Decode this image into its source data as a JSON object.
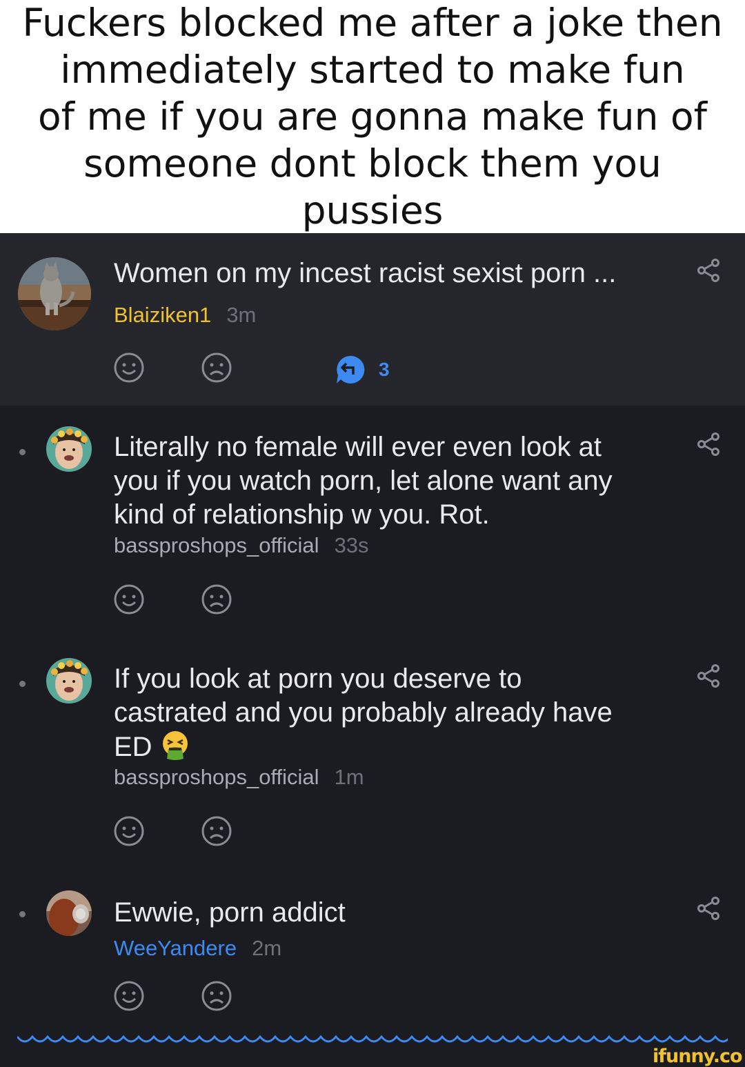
{
  "caption": {
    "line1": "Fuckers blocked me after a joke then",
    "line2": "immediately started to make fun",
    "line3": "of me if you are gonna make fun of",
    "line4": "someone dont block them you pussies"
  },
  "post": {
    "title": "Women on my incest racist sexist porn ...",
    "username": "Blaiziken1",
    "time": "3m",
    "reply_count": "3",
    "avatar_icon": "cat-photo-avatar"
  },
  "comments": [
    {
      "text_lines": [
        "Literally no female will ever even look at",
        "you if you watch porn, let alone want any",
        "kind of relationship w you. Rot."
      ],
      "username": "bassproshops_official",
      "time": "33s",
      "avatar_icon": "flower-crown-avatar"
    },
    {
      "text_lines": [
        "If you look at porn you deserve to",
        "castrated and you probably already have",
        "ED"
      ],
      "emoji": "vomiting-face-emoji",
      "username": "bassproshops_official",
      "time": "1m",
      "avatar_icon": "flower-crown-avatar"
    },
    {
      "text_lines": [
        "Ewwie, porn addict"
      ],
      "username": "WeeYandere",
      "time": "2m",
      "avatar_icon": "redhead-photo-avatar"
    }
  ],
  "branding": {
    "logo": "ifunny.co"
  },
  "colors": {
    "background": "#1b1c21",
    "op_background": "#25262b",
    "text": "#e9e9ee",
    "username_yellow": "#f2c22e",
    "username_blue": "#3d8bf2",
    "username_grey": "#a9aab3",
    "time": "#6f717a",
    "icon_grey": "#8a8c95",
    "reply_blue": "#3d8bf2"
  }
}
